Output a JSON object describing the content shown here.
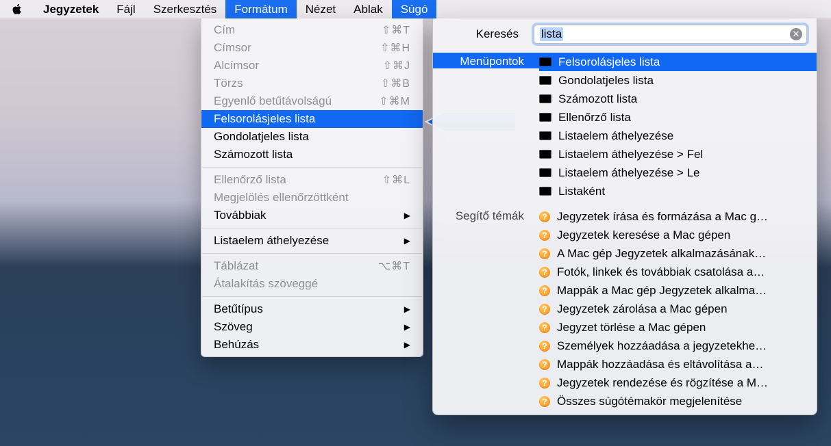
{
  "menubar": {
    "app": "Jegyzetek",
    "items": [
      "Fájl",
      "Szerkesztés",
      "Formátum",
      "Nézet",
      "Ablak",
      "Súgó"
    ],
    "open": [
      2,
      5
    ]
  },
  "dropdown": {
    "groups": [
      [
        {
          "label": "Cím",
          "shortcut": "⇧⌘T",
          "disabled": true
        },
        {
          "label": "Címsor",
          "shortcut": "⇧⌘H",
          "disabled": true
        },
        {
          "label": "Alcímsor",
          "shortcut": "⇧⌘J",
          "disabled": true
        },
        {
          "label": "Törzs",
          "shortcut": "⇧⌘B",
          "disabled": true
        },
        {
          "label": "Egyenlő betűtávolságú",
          "shortcut": "⇧⌘M",
          "disabled": true
        },
        {
          "label": "Felsorolásjeles lista",
          "selected": true
        },
        {
          "label": "Gondolatjeles lista"
        },
        {
          "label": "Számozott lista"
        }
      ],
      [
        {
          "label": "Ellenőrző lista",
          "shortcut": "⇧⌘L",
          "disabled": true
        },
        {
          "label": "Megjelölés ellenőrzöttként",
          "disabled": true
        },
        {
          "label": "Továbbiak",
          "submenu": true
        }
      ],
      [
        {
          "label": "Listaelem áthelyezése",
          "submenu": true
        }
      ],
      [
        {
          "label": "Táblázat",
          "shortcut": "⌥⌘T",
          "disabled": true
        },
        {
          "label": "Átalakítás szöveggé",
          "disabled": true
        }
      ],
      [
        {
          "label": "Betűtípus",
          "submenu": true
        },
        {
          "label": "Szöveg",
          "submenu": true
        },
        {
          "label": "Behúzás",
          "submenu": true
        }
      ]
    ]
  },
  "help": {
    "search_label": "Keresés",
    "query": "lista",
    "sections": [
      {
        "title": "Menüpontok",
        "kind": "menu",
        "items": [
          {
            "label": "Felsorolásjeles lista",
            "selected": true
          },
          {
            "label": "Gondolatjeles lista"
          },
          {
            "label": "Számozott lista"
          },
          {
            "label": "Ellenőrző lista"
          },
          {
            "label": "Listaelem áthelyezése"
          },
          {
            "label": "Listaelem áthelyezése > Fel"
          },
          {
            "label": "Listaelem áthelyezése > Le"
          },
          {
            "label": "Listaként"
          }
        ]
      },
      {
        "title": "Segítő témák",
        "kind": "topic",
        "items": [
          {
            "label": "Jegyzetek írása és formázása a Mac g…"
          },
          {
            "label": "Jegyzetek keresése a Mac gépen"
          },
          {
            "label": "A Mac gép Jegyzetek alkalmazásának…"
          },
          {
            "label": "Fotók, linkek és továbbiak csatolása a…"
          },
          {
            "label": "Mappák a Mac gép Jegyzetek alkalma…"
          },
          {
            "label": "Jegyzetek zárolása a Mac gépen"
          },
          {
            "label": "Jegyzet törlése a Mac gépen"
          },
          {
            "label": "Személyek hozzáadása a jegyzetekhe…"
          },
          {
            "label": "Mappák hozzáadása és eltávolítása a…"
          },
          {
            "label": "Jegyzetek rendezése és rögzítése a M…"
          },
          {
            "label": "Összes súgótémakör megjelenítése"
          }
        ]
      }
    ]
  }
}
